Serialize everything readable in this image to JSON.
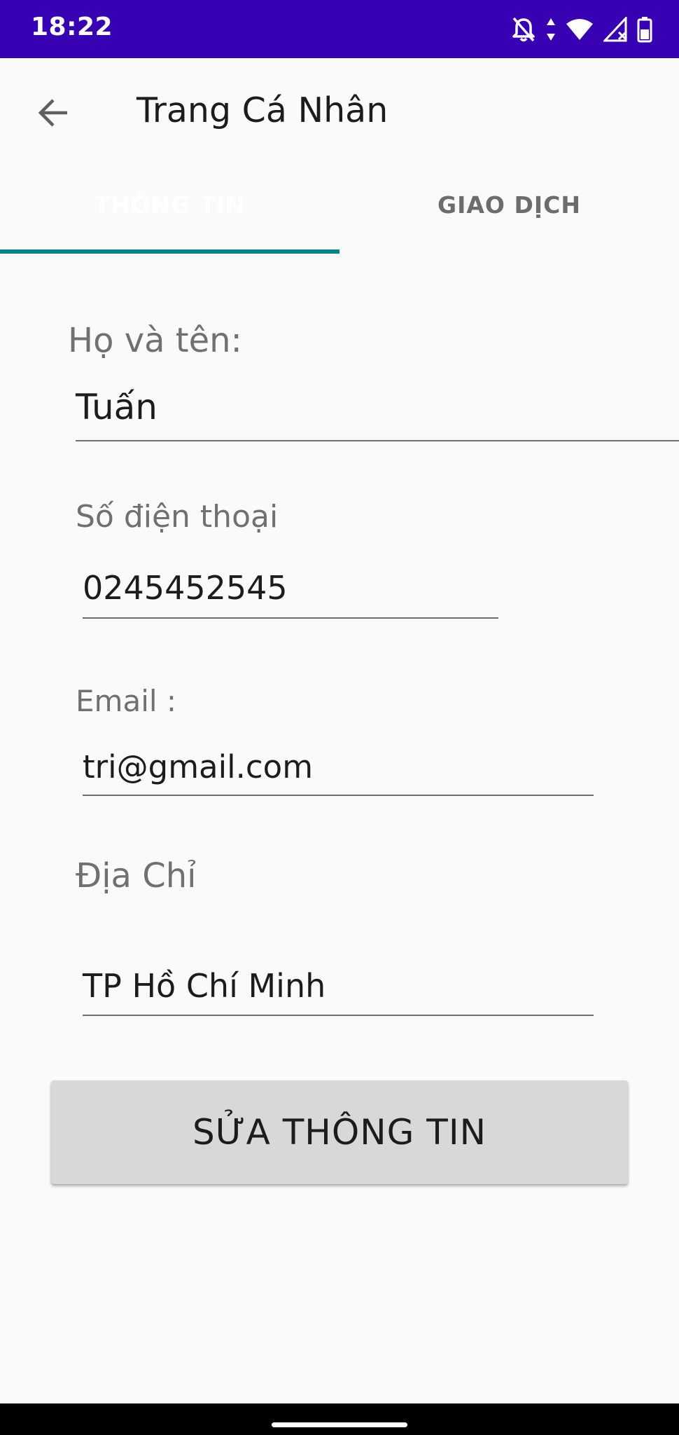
{
  "status_bar": {
    "time": "18:22",
    "icons": [
      "bell-off-icon",
      "data-arrows-icon",
      "wifi-icon",
      "signal-icon",
      "battery-icon"
    ]
  },
  "app_bar": {
    "title": "Trang Cá Nhân",
    "back_icon": "arrow-left-icon"
  },
  "tabs": [
    {
      "label": "THÔNG TIN",
      "selected": true
    },
    {
      "label": "GIAO DỊCH",
      "selected": false
    }
  ],
  "form": {
    "name_label": "Họ và tên:",
    "name_value": "Tuấn",
    "phone_label": "Số điện thoại",
    "phone_value": "0245452545",
    "email_label": "Email :",
    "email_value": "tri@gmail.com",
    "address_label": "Địa Chỉ",
    "address_value": "TP Hồ Chí Minh"
  },
  "edit_button_label": "SỬA THÔNG TIN",
  "colors": {
    "status_bar": "#3700b3",
    "tab_indicator": "#018786",
    "button_bg": "#d7d8d7",
    "background": "#fafafa"
  }
}
